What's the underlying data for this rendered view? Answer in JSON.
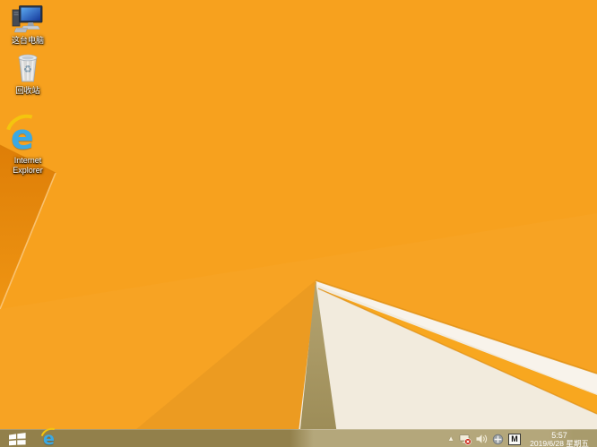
{
  "wallpaper": {
    "base_color": "#F7A11E",
    "fold_dark_color": "#E0800A",
    "fold_highlight_color": "#FBCA80",
    "white_wedge_color": "#F8F3EB",
    "pale_corner_color": "#F2EBDD",
    "tan_shadow_color": "#A9965E"
  },
  "desktop": {
    "icons": [
      {
        "id": "this-pc",
        "label": "这台电脑"
      },
      {
        "id": "recycle-bin",
        "label": "回收站"
      },
      {
        "id": "internet-explorer",
        "label": "Internet Explorer"
      }
    ]
  },
  "taskbar": {
    "background_color": "#92804B",
    "tray": {
      "ime_label": "M",
      "clock": {
        "time": "5:57",
        "date": "2019/6/28 星期五"
      }
    }
  }
}
